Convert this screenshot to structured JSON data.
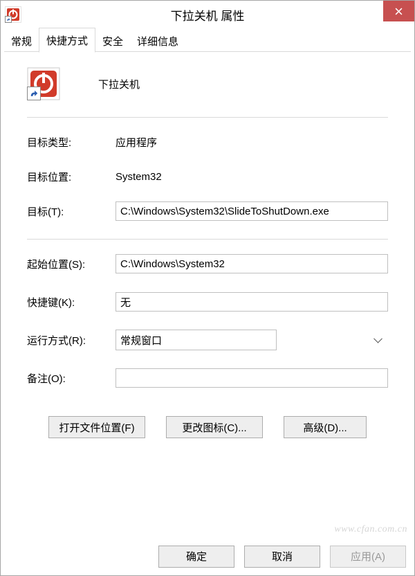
{
  "window": {
    "title": "下拉关机 属性"
  },
  "tabs": {
    "t0": "常规",
    "t1": "快捷方式",
    "t2": "安全",
    "t3": "详细信息"
  },
  "header": {
    "name": "下拉关机"
  },
  "fields": {
    "target_type_label": "目标类型:",
    "target_type_value": "应用程序",
    "target_location_label": "目标位置:",
    "target_location_value": "System32",
    "target_label": "目标(T):",
    "target_value": "C:\\Windows\\System32\\SlideToShutDown.exe",
    "start_in_label": "起始位置(S):",
    "start_in_value": "C:\\Windows\\System32",
    "shortcut_key_label": "快捷键(K):",
    "shortcut_key_value": "无",
    "run_label": "运行方式(R):",
    "run_value": "常规窗口",
    "comment_label": "备注(O):",
    "comment_value": ""
  },
  "buttons": {
    "open_location": "打开文件位置(F)",
    "change_icon": "更改图标(C)...",
    "advanced": "高级(D)...",
    "ok": "确定",
    "cancel": "取消",
    "apply": "应用(A)"
  },
  "watermark": "www.cfan.com.cn",
  "icon": {
    "name": "shortcut-app-icon"
  }
}
